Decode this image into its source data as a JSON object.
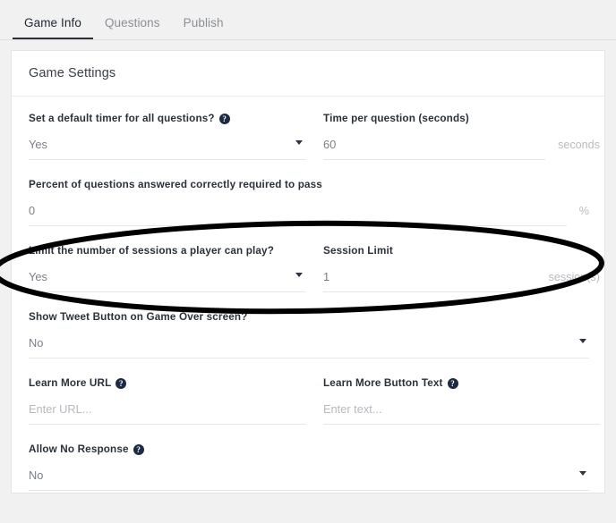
{
  "tabs": [
    {
      "label": "Game Info",
      "active": true
    },
    {
      "label": "Questions",
      "active": false
    },
    {
      "label": "Publish",
      "active": false
    }
  ],
  "card": {
    "title": "Game Settings"
  },
  "fields": {
    "default_timer": {
      "label": "Set a default timer for all questions?",
      "help": "?",
      "value": "Yes",
      "caret": "chevron-down-icon"
    },
    "time_per_question": {
      "label": "Time per question (seconds)",
      "value": "60",
      "suffix": "seconds"
    },
    "percent_to_pass": {
      "label": "Percent of questions answered correctly required to pass",
      "value": "0",
      "suffix": "%"
    },
    "limit_sessions": {
      "label": "Limit the number of sessions a player can play?",
      "value": "Yes",
      "caret": "chevron-down-icon"
    },
    "session_limit": {
      "label": "Session Limit",
      "value": "1",
      "suffix": "session(s)"
    },
    "show_tweet_button": {
      "label": "Show Tweet Button on Game Over screen?",
      "value": "No",
      "caret": "chevron-down-icon"
    },
    "learn_more_url": {
      "label": "Learn More URL",
      "help": "?",
      "value": "",
      "placeholder": "Enter URL..."
    },
    "learn_more_button_text": {
      "label": "Learn More Button Text",
      "help": "?",
      "value": "",
      "placeholder": "Enter text..."
    },
    "allow_no_response": {
      "label": "Allow No Response",
      "help": "?",
      "value": "No",
      "caret": "chevron-down-icon"
    }
  },
  "annotation": {
    "shape": "ellipse-highlight",
    "color": "#000000"
  }
}
